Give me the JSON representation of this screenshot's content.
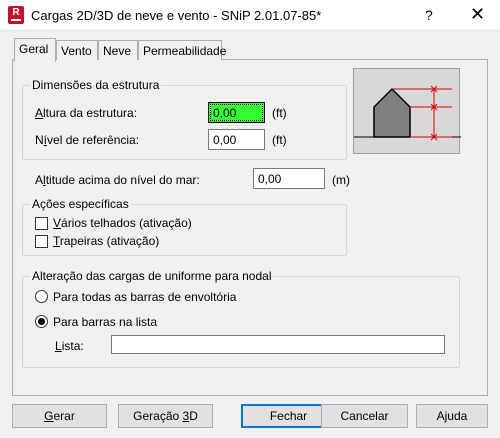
{
  "window": {
    "app_icon_letter": "R",
    "title": "Cargas 2D/3D de neve e vento - SNiP 2.01.07-85*",
    "help_glyph": "?",
    "close_glyph": "✕"
  },
  "tabs": [
    {
      "label": "Geral",
      "active": true
    },
    {
      "label": "Vento",
      "active": false
    },
    {
      "label": "Neve",
      "active": false
    },
    {
      "label": "Permeabilidade",
      "active": false
    }
  ],
  "dimensions": {
    "group_label": "Dimensões da estrutura",
    "height": {
      "label_prefix": "",
      "label_underline": "A",
      "label_rest": "ltura da estrutura:",
      "value": "0,00",
      "unit": "(ft)"
    },
    "reference": {
      "label_prefix": "N",
      "label_underline": "í",
      "label_rest": "vel de referência:",
      "value": "0,00",
      "unit": "(ft)"
    }
  },
  "altitude": {
    "label_prefix": "A",
    "label_underline": "l",
    "label_rest": "titude acima do nível do mar:",
    "value": "0,00",
    "unit": "(m)"
  },
  "specific_actions": {
    "group_label": "Ações específicas",
    "multiple_roofs": {
      "label_underline": "V",
      "label_rest": "ários telhados (ativação)",
      "checked": false
    },
    "dormers": {
      "label_underline": "T",
      "label_rest": "rapeiras (ativação)",
      "checked": false
    }
  },
  "conversion": {
    "group_label": "Alteração das cargas de uniforme para nodal",
    "all_bars": {
      "label": "Para todas as barras de envoltória",
      "selected": false
    },
    "list_bars": {
      "label": "Para barras na lista",
      "selected": true
    },
    "list": {
      "label_underline": "L",
      "label_rest": "ista:",
      "value": ""
    }
  },
  "buttons": {
    "generate": {
      "label_underline": "G",
      "label_rest": "erar"
    },
    "generate3d": {
      "label_before": "Geração ",
      "label_underline": "3",
      "label_rest": "D"
    },
    "close": "Fechar",
    "cancel": "Cancelar",
    "help": "Ajuda"
  },
  "colors": {
    "accent": "#0078d7",
    "highlight_input": "#33ff33",
    "dimension_lines": "#e00000",
    "app_icon": "#c8102e"
  }
}
